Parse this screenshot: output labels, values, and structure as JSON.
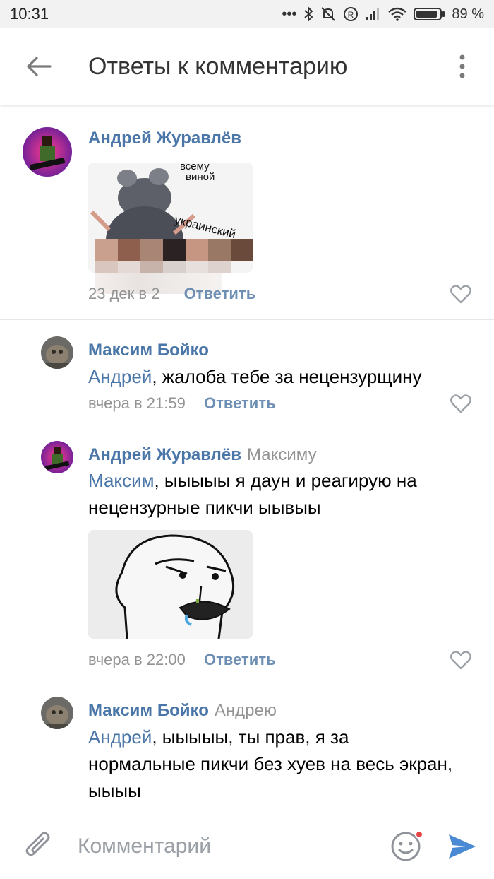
{
  "status_bar": {
    "time": "10:31",
    "dots": "•••",
    "battery_level": 0.89,
    "battery_text": "89 %"
  },
  "header": {
    "title": "Ответы к комментарию"
  },
  "comments": [
    {
      "author": "Андрей Журавлёв",
      "reply_to": "",
      "mention": "",
      "text": "",
      "timestamp": "23 дек в 2",
      "reply_label": "Ответить",
      "image_caption_top": "всему",
      "image_caption_mid": "виной",
      "image_caption_curve": "украинский"
    },
    {
      "author": "Максим Бойко",
      "reply_to": "",
      "mention": "Андрей",
      "text": ", жалоба тебе за нецензурщину",
      "timestamp": "вчера в 21:59",
      "reply_label": "Ответить"
    },
    {
      "author": "Андрей Журавлёв",
      "reply_to": "Максиму",
      "mention": "Максим",
      "text": ", ыыыыы я даун и реагирую на нецензурные пикчи ыывыы",
      "timestamp": "вчера в 22:00",
      "reply_label": "Ответить"
    },
    {
      "author": "Максим Бойко",
      "reply_to": "Андрею",
      "mention": "Андрей",
      "text": ", ыыыыы, ты прав, я за нормальные пикчи без хуев на весь экран, ыыыы",
      "timestamp": "",
      "reply_label": ""
    }
  ],
  "input": {
    "placeholder": "Комментарий"
  },
  "colors": {
    "link": "#4a76a8",
    "meta": "#939393",
    "send": "#4a8ad4",
    "notification_dot": "#e64646"
  }
}
